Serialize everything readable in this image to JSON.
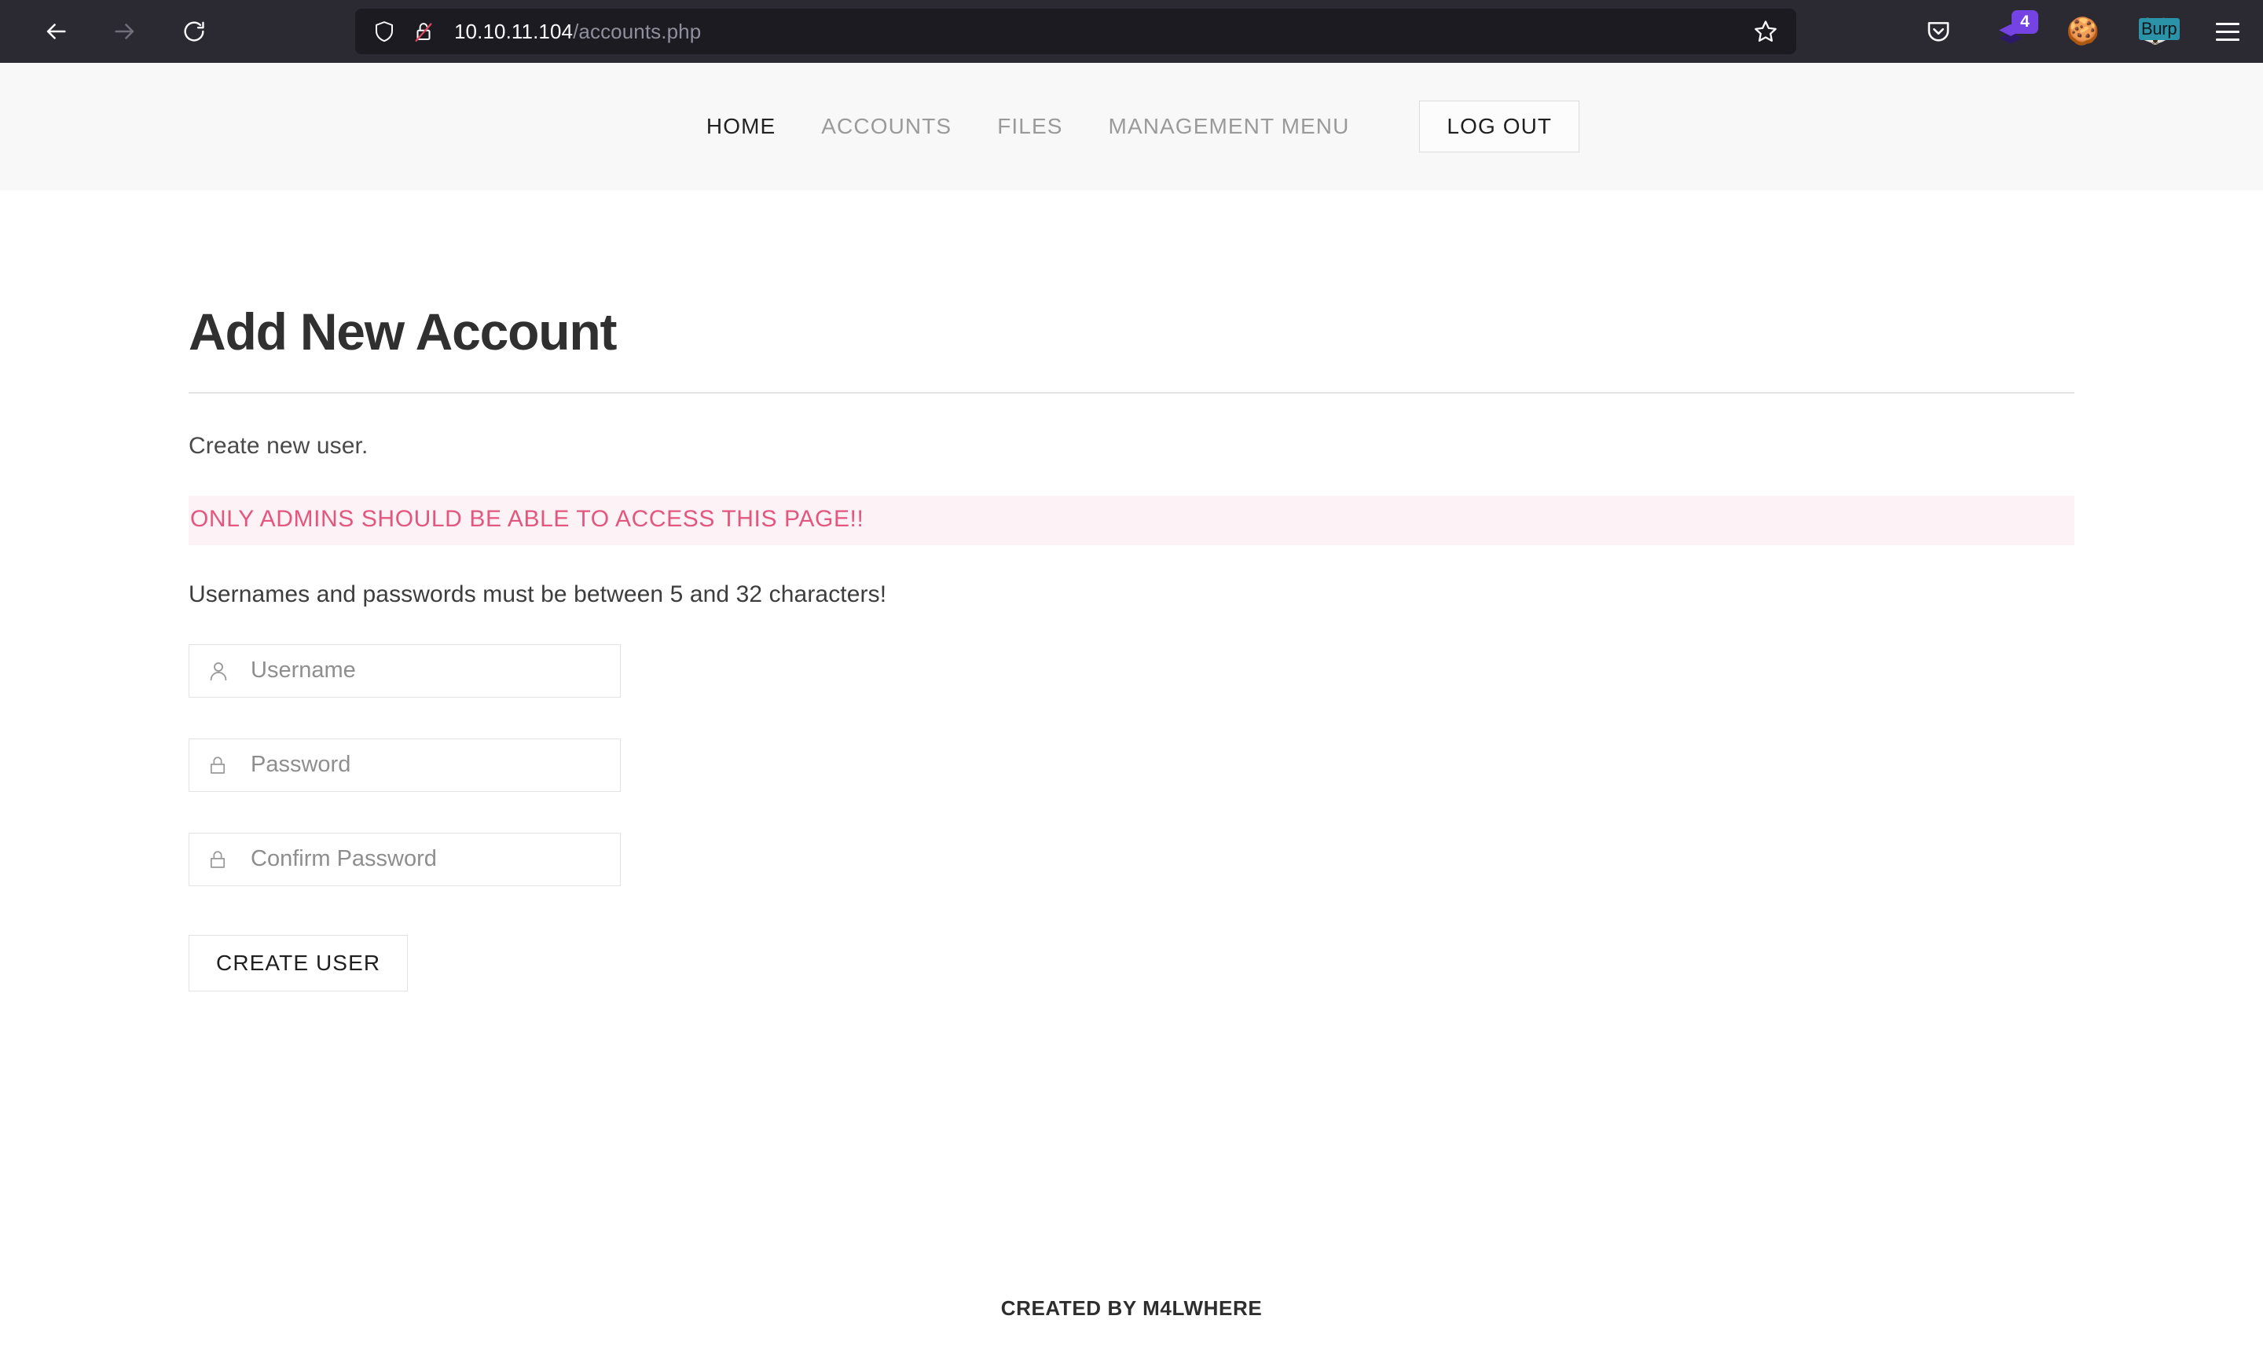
{
  "browser": {
    "back_label": "Back",
    "forward_label": "Forward",
    "reload_label": "Reload",
    "url_host": "10.10.11.104",
    "url_path": "/accounts.php",
    "shield_icon": "shield-icon",
    "insecure_icon": "broken-lock-icon",
    "bookmark_icon": "star-icon",
    "extensions": [
      {
        "name": "pocket-icon",
        "badge": ""
      },
      {
        "name": "layers-extension-icon",
        "badge": "4"
      },
      {
        "name": "cookie-extension-icon",
        "glyph": "🍪",
        "badge": ""
      },
      {
        "name": "burp-extension-icon",
        "glyph": "🦊",
        "label": "Burp",
        "badge": ""
      }
    ],
    "menu_label": "Open application menu"
  },
  "nav": {
    "links": [
      {
        "label": "HOME",
        "active": true
      },
      {
        "label": "ACCOUNTS",
        "active": false
      },
      {
        "label": "FILES",
        "active": false
      },
      {
        "label": "MANAGEMENT MENU",
        "active": false
      }
    ],
    "logout_label": "LOG OUT"
  },
  "main": {
    "title": "Add New Account",
    "lead": "Create new user.",
    "alert": "ONLY ADMINS SHOULD BE ABLE TO ACCESS THIS PAGE!!",
    "hint": "Usernames and passwords must be between 5 and 32 characters!",
    "fields": [
      {
        "name": "username",
        "placeholder": "Username",
        "value": "",
        "icon": "user-icon"
      },
      {
        "name": "password",
        "placeholder": "Password",
        "value": "",
        "icon": "lock-icon"
      },
      {
        "name": "confirm-password",
        "placeholder": "Confirm Password",
        "value": "",
        "icon": "lock-icon"
      }
    ],
    "submit_label": "CREATE USER"
  },
  "footer": {
    "text": "CREATED BY M4LWHERE"
  },
  "colors": {
    "chrome_bg": "#2b2a33",
    "urlbar_bg": "#1c1b22",
    "nav_bg": "#f8f8f8",
    "alert_text": "#e3577f",
    "alert_bg": "#fdf2f5",
    "accent_purple": "#7542e4"
  }
}
